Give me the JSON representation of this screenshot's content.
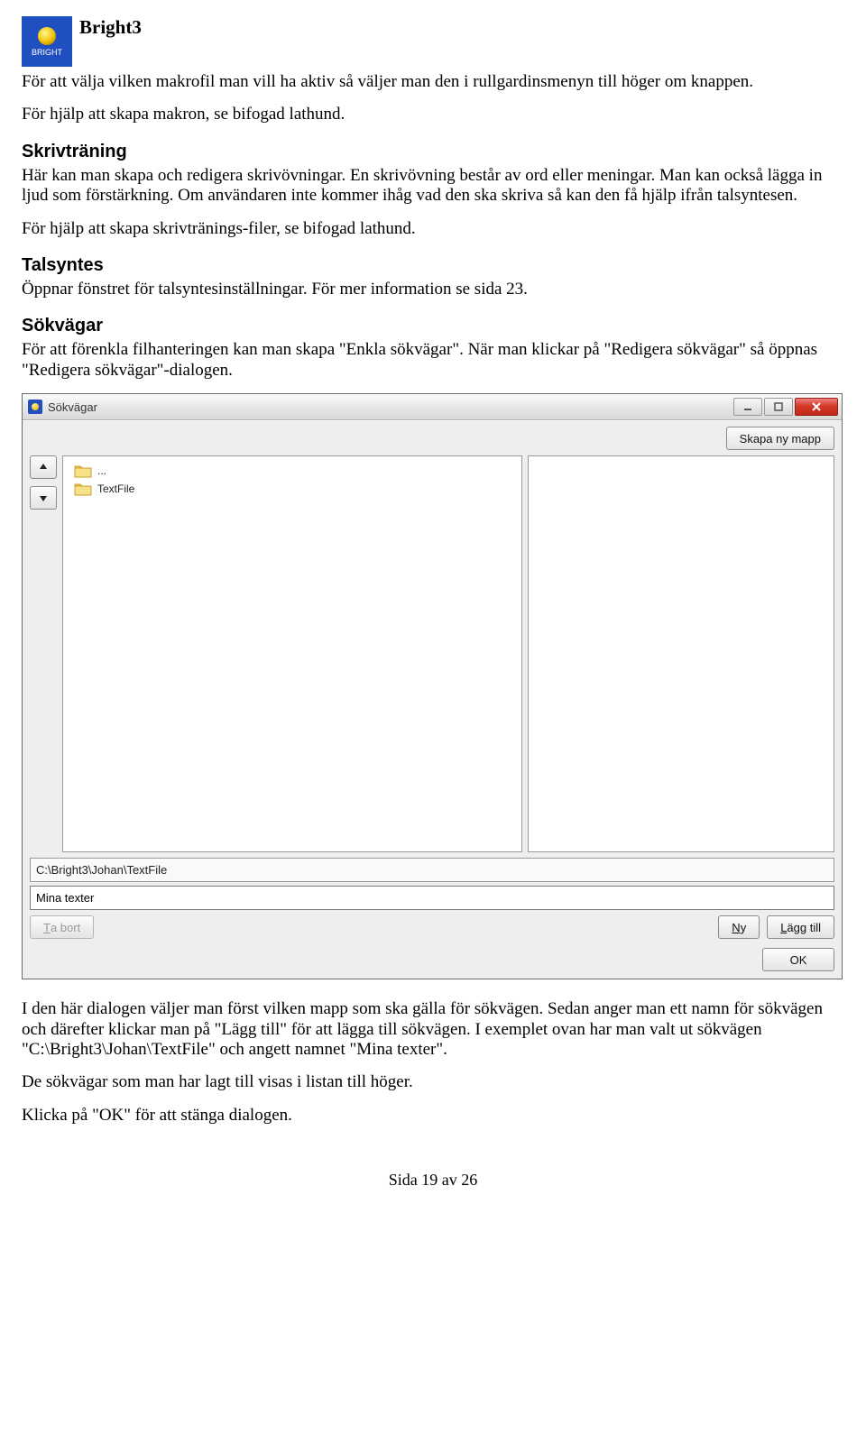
{
  "header": {
    "title": "Bright3",
    "logo_caption": "BRIGHT"
  },
  "paragraphs": {
    "p1": "För att välja vilken makrofil man vill ha aktiv så väljer man den i rullgardinsmenyn till höger om knappen.",
    "p2": "För hjälp att skapa makron, se bifogad lathund.",
    "h_skriv": "Skrivträning",
    "p3": "Här kan man skapa och redigera skrivövningar. En skrivövning består av ord eller meningar. Man kan också lägga in ljud som förstärkning. Om användaren inte kommer ihåg vad den ska skriva så kan den få hjälp ifrån talsyntesen.",
    "p4": "För hjälp att skapa skrivtränings-filer, se bifogad lathund.",
    "h_tal": "Talsyntes",
    "p5": "Öppnar fönstret för talsyntesinställningar. För mer information se sida 23.",
    "h_sok": "Sökvägar",
    "p6": "För att förenkla filhanteringen kan man skapa \"Enkla sökvägar\". När man klickar på \"Redigera sökvägar\" så öppnas \"Redigera sökvägar\"-dialogen.",
    "p7": "I den här dialogen väljer man först vilken mapp som ska gälla för sökvägen. Sedan anger man ett namn för sökvägen och därefter klickar man på \"Lägg till\" för att lägga till sökvägen. I exemplet ovan har man valt ut sökvägen \"C:\\Bright3\\Johan\\TextFile\" och angett namnet \"Mina texter\".",
    "p8": "De sökvägar som man har lagt till visas i listan till höger.",
    "p9": "Klicka på \"OK\" för att stänga dialogen."
  },
  "dialog": {
    "title": "Sökvägar",
    "buttons": {
      "new_folder": "Skapa ny mapp",
      "remove": "Ta bort",
      "ny": "Ny",
      "lagg": "Lägg till",
      "ok": "OK"
    },
    "tree": [
      {
        "label": "..."
      },
      {
        "label": "TextFile"
      }
    ],
    "path": "C:\\Bright3\\Johan\\TextFile",
    "name_value": "Mina texter"
  },
  "footer": "Sida 19 av 26"
}
